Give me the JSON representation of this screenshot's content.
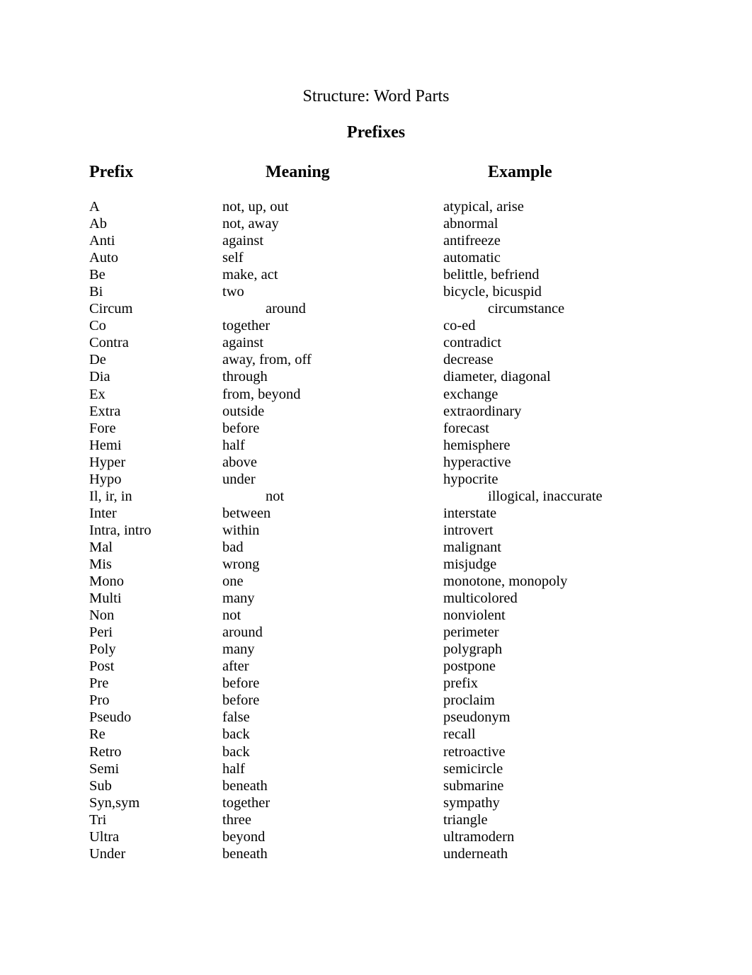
{
  "document": {
    "title": "Structure:  Word Parts",
    "section_title": "Prefixes",
    "columns": {
      "prefix": "Prefix",
      "meaning": "Meaning",
      "example": "Example"
    },
    "rows": [
      {
        "prefix": "A",
        "meaning": "not, up, out",
        "example": "atypical, arise",
        "indented": false
      },
      {
        "prefix": "Ab",
        "meaning": "not, away",
        "example": "abnormal",
        "indented": false
      },
      {
        "prefix": "Anti",
        "meaning": "against",
        "example": "antifreeze",
        "indented": false
      },
      {
        "prefix": "Auto",
        "meaning": "self",
        "example": "automatic",
        "indented": false
      },
      {
        "prefix": "Be",
        "meaning": "make, act",
        "example": "belittle, befriend",
        "indented": false
      },
      {
        "prefix": "Bi",
        "meaning": "two",
        "example": "bicycle, bicuspid",
        "indented": false
      },
      {
        "prefix": "Circum",
        "meaning": "around",
        "example": "circumstance",
        "indented": true
      },
      {
        "prefix": "Co",
        "meaning": "together",
        "example": "co-ed",
        "indented": false
      },
      {
        "prefix": "Contra",
        "meaning": "against",
        "example": "contradict",
        "indented": false
      },
      {
        "prefix": "De",
        "meaning": "away, from, off",
        "example": "decrease",
        "indented": false
      },
      {
        "prefix": "Dia",
        "meaning": "through",
        "example": "diameter, diagonal",
        "indented": false
      },
      {
        "prefix": "Ex",
        "meaning": "from, beyond",
        "example": "exchange",
        "indented": false
      },
      {
        "prefix": "Extra",
        "meaning": "outside",
        "example": "extraordinary",
        "indented": false
      },
      {
        "prefix": "Fore",
        "meaning": "before",
        "example": "forecast",
        "indented": false
      },
      {
        "prefix": "Hemi",
        "meaning": "half",
        "example": "hemisphere",
        "indented": false
      },
      {
        "prefix": "Hyper",
        "meaning": "above",
        "example": "hyperactive",
        "indented": false
      },
      {
        "prefix": "Hypo",
        "meaning": "under",
        "example": "hypocrite",
        "indented": false
      },
      {
        "prefix": "Il, ir, in",
        "meaning": "not",
        "example": "illogical, inaccurate",
        "indented": true
      },
      {
        "prefix": "Inter",
        "meaning": "between",
        "example": "interstate",
        "indented": false
      },
      {
        "prefix": "Intra, intro",
        "meaning": "within",
        "example": "introvert",
        "indented": false
      },
      {
        "prefix": "Mal",
        "meaning": "bad",
        "example": "malignant",
        "indented": false
      },
      {
        "prefix": "Mis",
        "meaning": "wrong",
        "example": "misjudge",
        "indented": false
      },
      {
        "prefix": "Mono",
        "meaning": "one",
        "example": "monotone, monopoly",
        "indented": false
      },
      {
        "prefix": "Multi",
        "meaning": "many",
        "example": "multicolored",
        "indented": false
      },
      {
        "prefix": "Non",
        "meaning": "not",
        "example": "nonviolent",
        "indented": false
      },
      {
        "prefix": "Peri",
        "meaning": "around",
        "example": "perimeter",
        "indented": false
      },
      {
        "prefix": "Poly",
        "meaning": "many",
        "example": "polygraph",
        "indented": false
      },
      {
        "prefix": "Post",
        "meaning": "after",
        "example": "postpone",
        "indented": false
      },
      {
        "prefix": "Pre",
        "meaning": "before",
        "example": "prefix",
        "indented": false
      },
      {
        "prefix": "Pro",
        "meaning": "before",
        "example": "proclaim",
        "indented": false
      },
      {
        "prefix": "Pseudo",
        "meaning": "false",
        "example": "pseudonym",
        "indented": false
      },
      {
        "prefix": "Re",
        "meaning": "back",
        "example": "recall",
        "indented": false
      },
      {
        "prefix": "Retro",
        "meaning": "back",
        "example": "retroactive",
        "indented": false
      },
      {
        "prefix": "Semi",
        "meaning": "half",
        "example": "semicircle",
        "indented": false
      },
      {
        "prefix": "Sub",
        "meaning": "beneath",
        "example": "submarine",
        "indented": false
      },
      {
        "prefix": "Syn,sym",
        "meaning": "together",
        "example": "sympathy",
        "indented": false
      },
      {
        "prefix": "Tri",
        "meaning": "three",
        "example": "triangle",
        "indented": false
      },
      {
        "prefix": "Ultra",
        "meaning": "beyond",
        "example": "ultramodern",
        "indented": false
      },
      {
        "prefix": "Under",
        "meaning": "beneath",
        "example": "underneath",
        "indented": false
      }
    ]
  }
}
